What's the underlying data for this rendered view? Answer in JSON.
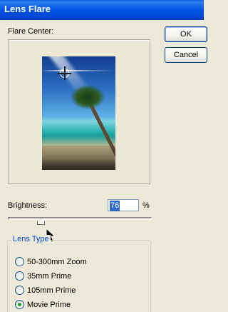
{
  "window": {
    "title": "Lens Flare"
  },
  "flare_center": {
    "label": "Flare Center:"
  },
  "buttons": {
    "ok": "OK",
    "cancel": "Cancel"
  },
  "brightness": {
    "label": "Brightness:",
    "value": "76",
    "unit": "%",
    "slider_fraction": 0.24
  },
  "lens_type": {
    "legend": "Lens Type",
    "options": [
      "50-300mm Zoom",
      "35mm Prime",
      "105mm Prime",
      "Movie Prime"
    ],
    "selected": "Movie Prime"
  },
  "colors": {
    "titlebar": "#0055e5",
    "legend": "#0046d5",
    "selection": "#316ac5"
  }
}
